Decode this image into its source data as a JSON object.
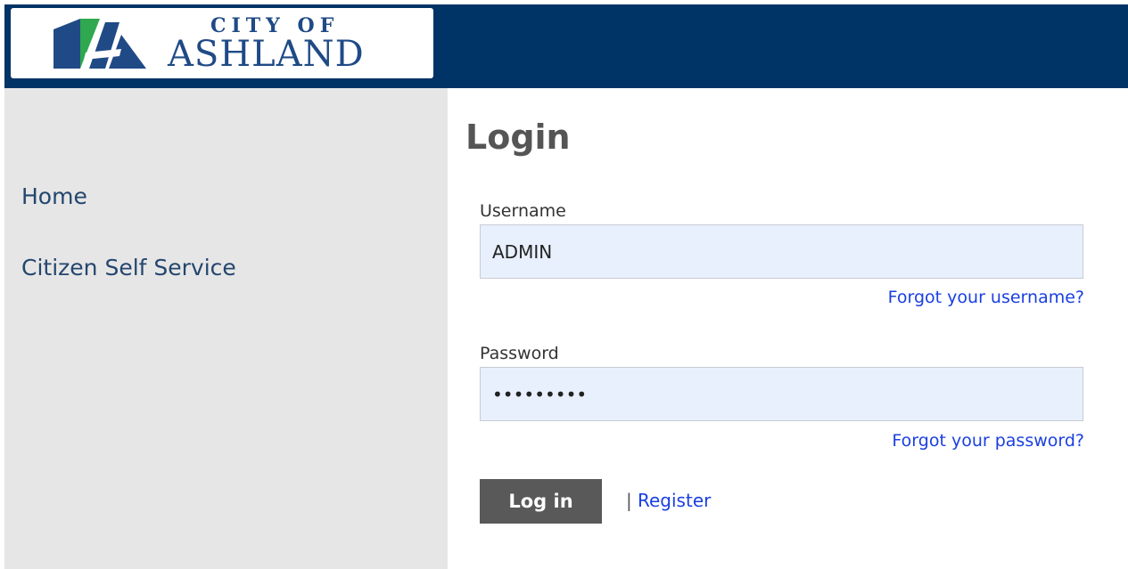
{
  "header": {
    "logo": {
      "line1": "CITY OF",
      "line2": "ASHLAND",
      "icon": "ashland-logo-icon"
    },
    "background_color": "#003366"
  },
  "sidebar": {
    "items": [
      {
        "label": "Home"
      },
      {
        "label": "Citizen Self Service"
      }
    ]
  },
  "main": {
    "title": "Login",
    "username": {
      "label": "Username",
      "value": "ADMIN",
      "forgot": "Forgot your username?"
    },
    "password": {
      "label": "Password",
      "value": "•••••••••",
      "forgot": "Forgot your password?"
    },
    "login_button": "Log in",
    "separator": "|",
    "register": "Register"
  },
  "colors": {
    "brand_navy": "#003366",
    "link_blue": "#1a3fe0",
    "button_gray": "#595959",
    "sidebar_gray": "#e6e6e6",
    "logo_green": "#2fa84f",
    "logo_blue": "#1f4a86"
  }
}
